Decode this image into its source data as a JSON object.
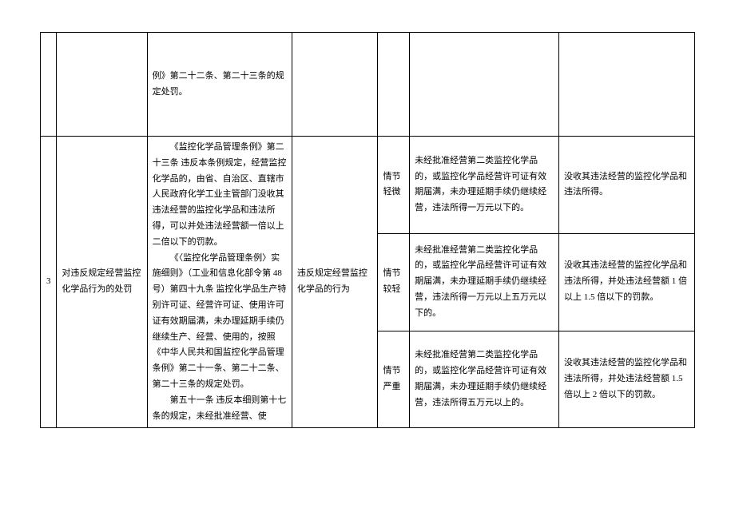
{
  "row1": {
    "basis": "例》第二十二条、第二十三条的规定处罚。"
  },
  "row2": {
    "index": "3",
    "title": "对违反规定经营监控化学品行为的处罚",
    "basis_p1": "《监控化学品管理条例》第二十三条 违反本条例规定，经营监控化学品的，由省、自治区、直辖市人民政府化学工业主管部门没收其违法经营的监控化学品和违法所得，可以并处违法经营额一倍以上二倍以下的罚款。",
    "basis_p2": "《〈监控化学品管理条例〉实施细则》（工业和信息化部令第 48 号）第四十九条 监控化学品生产特别许可证、经营许可证、使用许可证有效期届满，未办理延期手续仍继续生产、经营、使用的，按照《中华人民共和国监控化学品管理条例》第二十一条、第二十二条、第二十三条的规定处罚。",
    "basis_p3": "第五十一条 违反本细则第十七条的规定，未经批准经营、使",
    "type": "违反规定经营监控化学品的行为",
    "levels": [
      {
        "name": "情节轻微",
        "circumstance": "未经批准经营第二类监控化学品的，或监控化学品经营许可证有效期届满，未办理延期手续仍继续经营，违法所得一万元以下的。",
        "action": "没收其违法经营的监控化学品和违法所得。"
      },
      {
        "name": "情节较轻",
        "circumstance": "未经批准经营第二类监控化学品的，或监控化学品经营许可证有效期届满，未办理延期手续仍继续经营，违法所得一万元以上五万元以下的。",
        "action": "没收其违法经营的监控化学品和违法所得，并处违法经营额 1 倍以上 1.5 倍以下的罚款。"
      },
      {
        "name": "情节严重",
        "circumstance": "未经批准经营第二类监控化学品的，或监控化学品经营许可证有效期届满，未办理延期手续仍继续经营，违法所得五万元以上的。",
        "action": "没收其违法经营的监控化学品和违法所得，并处违法经营额 1.5 倍以上 2 倍以下的罚款。"
      }
    ]
  }
}
